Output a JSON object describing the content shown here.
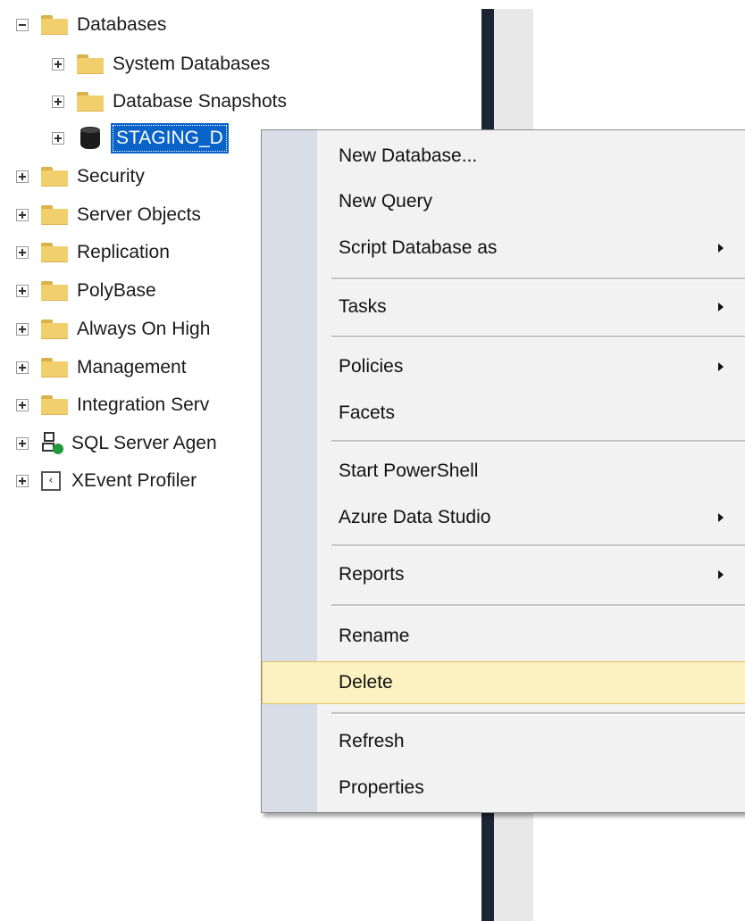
{
  "tree": {
    "databases": {
      "label": "Databases",
      "expanded": true
    },
    "children": [
      {
        "label": "System Databases"
      },
      {
        "label": "Database Snapshots"
      }
    ],
    "selected_db": {
      "label": "STAGING_D"
    },
    "siblings": [
      {
        "label": "Security",
        "icon": "folder-icon"
      },
      {
        "label": "Server Objects",
        "icon": "folder-icon"
      },
      {
        "label": "Replication",
        "icon": "folder-icon"
      },
      {
        "label": "PolyBase",
        "icon": "folder-icon"
      },
      {
        "label": "Always On High",
        "icon": "folder-icon"
      },
      {
        "label": "Management",
        "icon": "folder-icon"
      },
      {
        "label": "Integration Serv",
        "icon": "folder-icon"
      },
      {
        "label": "SQL Server Agen",
        "icon": "sql-agent-icon"
      },
      {
        "label": "XEvent Profiler",
        "icon": "xevent-profiler-icon"
      }
    ]
  },
  "context_menu": {
    "items": [
      {
        "label": "New Database...",
        "submenu": false
      },
      {
        "label": "New Query",
        "submenu": false
      },
      {
        "label": "Script Database as",
        "submenu": true
      },
      {
        "label": "Tasks",
        "submenu": true
      },
      {
        "label": "Policies",
        "submenu": true
      },
      {
        "label": "Facets",
        "submenu": false
      },
      {
        "label": "Start PowerShell",
        "submenu": false
      },
      {
        "label": "Azure Data Studio",
        "submenu": true
      },
      {
        "label": "Reports",
        "submenu": true
      },
      {
        "label": "Rename",
        "submenu": false
      },
      {
        "label": "Delete",
        "submenu": false,
        "highlighted": true
      },
      {
        "label": "Refresh",
        "submenu": false
      },
      {
        "label": "Properties",
        "submenu": false
      }
    ]
  },
  "colors": {
    "selection": "#0a63c9",
    "menu_highlight": "#fcf1c0",
    "menu_gutter": "#d8dde8",
    "splitter": "#1d2433"
  }
}
